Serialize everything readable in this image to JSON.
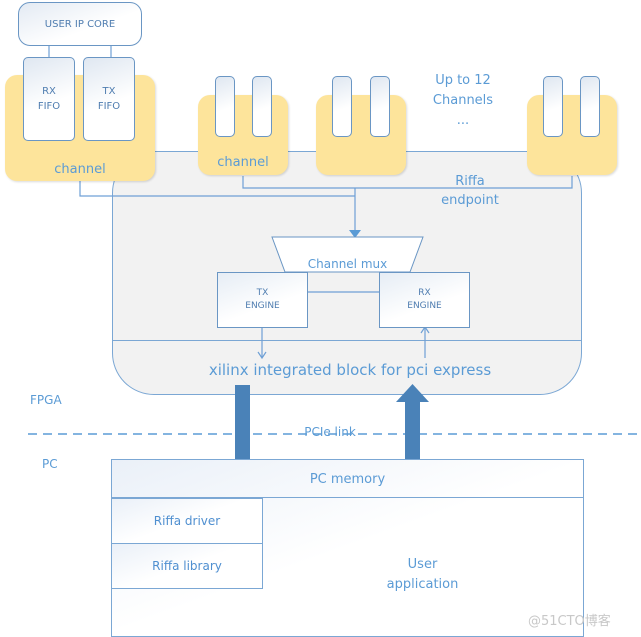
{
  "diagram": {
    "user_ip_core": "USER IP CORE",
    "rx_fifo": [
      "RX",
      "FIFO"
    ],
    "tx_fifo": [
      "TX",
      "FIFO"
    ],
    "channel_label": "channel",
    "up_to_channels": [
      "Up to 12",
      "Channels",
      "..."
    ],
    "riffa_endpoint": [
      "Riffa",
      "endpoint"
    ],
    "channel_mux": "Channel mux",
    "tx_engine": [
      "TX",
      "ENGINE"
    ],
    "rx_engine": [
      "RX",
      "ENGINE"
    ],
    "pcie_block": "xilinx integrated block for pci express",
    "fpga_label": "FPGA",
    "pcie_link": "PCIe link",
    "pc_label": "PC",
    "pc_memory": "PC memory",
    "riffa_driver": "Riffa driver",
    "riffa_library": "Riffa library",
    "user_application": [
      "User",
      "application"
    ],
    "watermark": "@51CTO博客",
    "colors": {
      "channel_fill": "#fde49b",
      "endpoint_fill": "#f2f2f2",
      "line": "#6fa0d6",
      "text": "#5b9bd5",
      "arrow": "#4a82b8"
    }
  }
}
